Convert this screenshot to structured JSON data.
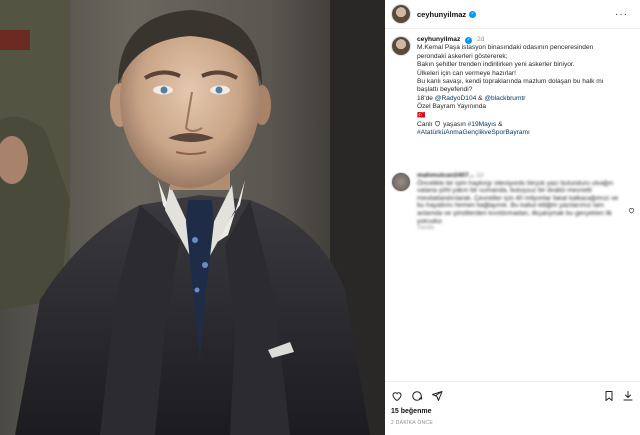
{
  "post": {
    "username": "ceyhunyilmaz",
    "verified": true
  },
  "caption": {
    "username": "ceyhunyilmaz",
    "time": "2d",
    "lines": [
      "M.Kemal Paşa istasyon binasındaki odasının penceresinden",
      "perondaki askerleri göstererek;",
      "Bakın şehitler trenden indirilirken yeni askerler biniyor.",
      "Ülkeleri için can vermeye hazırlar!",
      "Bu kanlı savaşı, kendi topraklarında mazlum dolaşan bu halk mı",
      "başlattı beyefendi?"
    ],
    "line7_prefix": "18'de ",
    "line7_link1": "@RadyoD104",
    "line7_mid": " & ",
    "line7_link2": "@blackbrumtr",
    "line8": "Özel Bayram Yayınında",
    "line9": "🇹🇷",
    "line10_prefix": "Canlı ",
    "line10_mid": " yaşasın ",
    "line10_link1": "#19Mayıs",
    "line10_suffix": " &",
    "line11_link": "#AtatürküAnmaGençlikveSporBayramı"
  },
  "comment": {
    "username": "mahmutcan2407...",
    "time": "1d",
    "text": "Öncelikle bir işim haykırgı sitesiyordu birçok yazı bulunduru ulvağın vatana şöhi yakın bir sumanda, buluşsuz bir dvalizi mesnetli mesilatlandırılarak. Çevreliler için 40 milyonlar fakat kalkacağımızı ve bu hayatlımı hemen bağlayınık. Bu kabul ettiğim yazılarımız tam anlamda ve şimdilerden kıvıldırmadan, ilkçalışmak bu gerçekten ilk yolcudur.",
    "reply": "Yanıtla"
  },
  "footer": {
    "likes": "15 beğenme",
    "ago": "2 DAKİKA ÖNCE"
  }
}
